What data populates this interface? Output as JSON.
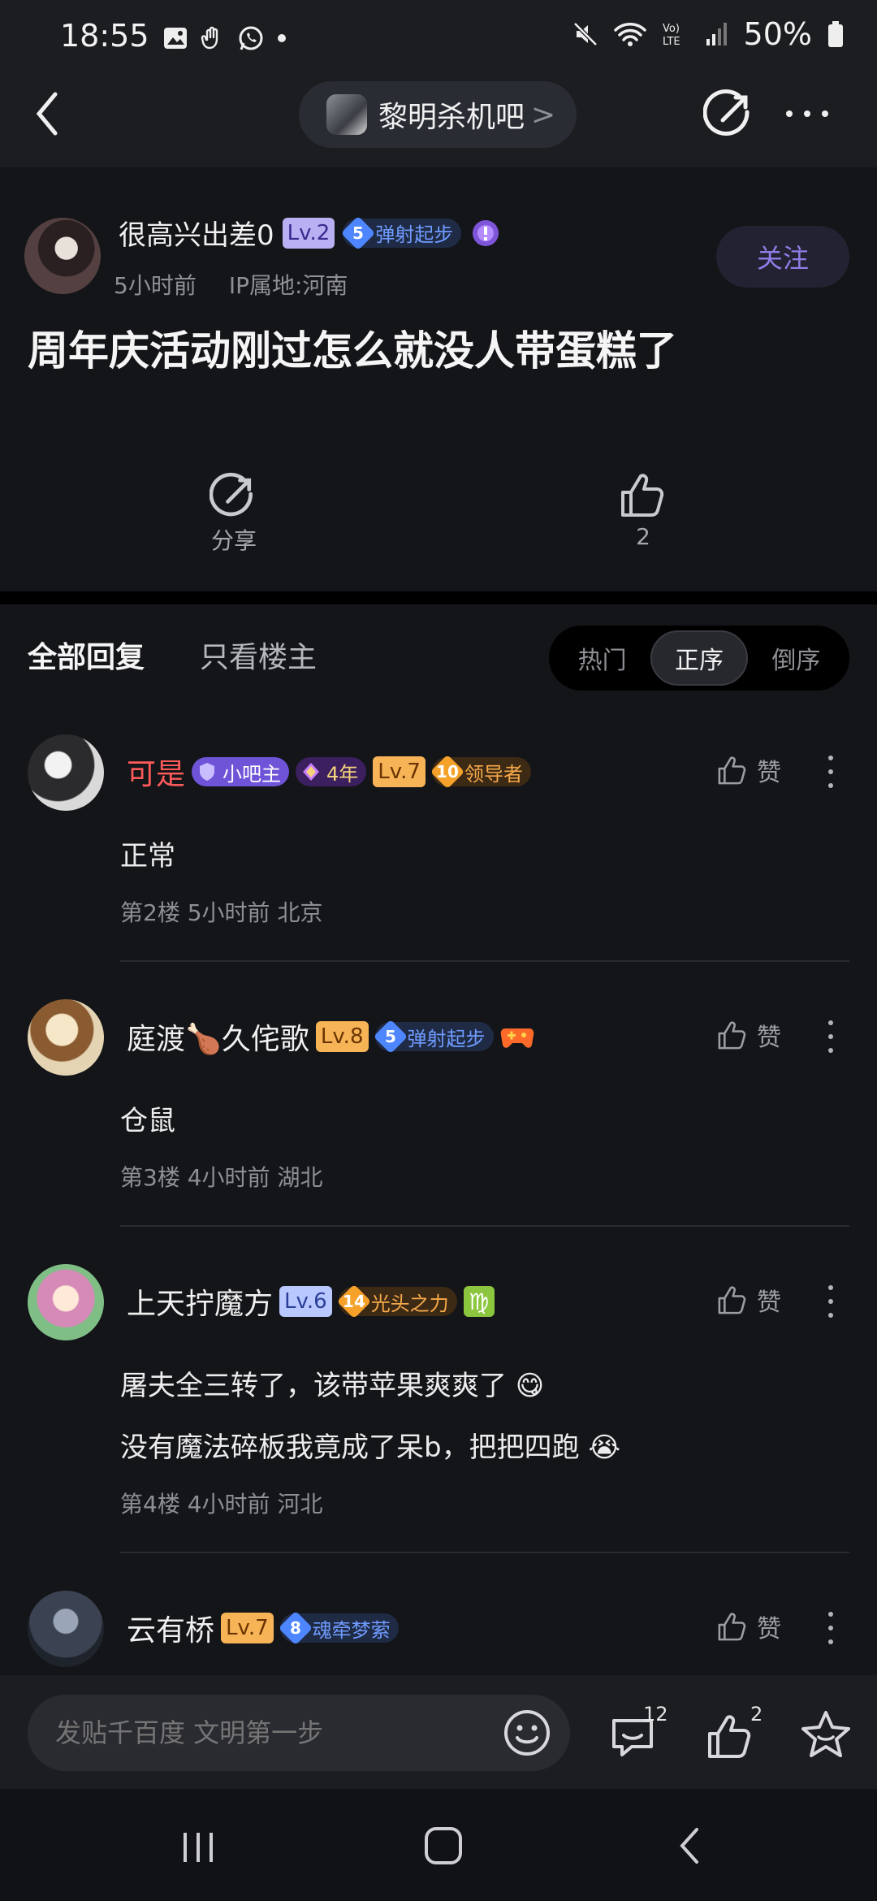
{
  "status_bar": {
    "time": "18:55",
    "battery": "50%"
  },
  "header": {
    "forum_name": "黎明杀机吧",
    "forum_chevron": ">"
  },
  "post": {
    "author": "很高兴出差0",
    "level": "Lv.2",
    "badge_num": "5",
    "badge_text": "弹射起步",
    "time": "5小时前",
    "ip": "IP属地:河南",
    "follow_label": "关注",
    "title": "周年庆活动刚过怎么就没人带蛋糕了",
    "share_label": "分享",
    "like_count": "2"
  },
  "reply_tabs": {
    "all": "全部回复",
    "op_only": "只看楼主",
    "sort": [
      "热门",
      "正序",
      "倒序"
    ]
  },
  "comments": [
    {
      "name": "可是",
      "name_color": "#ff5b5b",
      "role": "小吧主",
      "years": "4年",
      "level": "Lv.7",
      "badge_num": "10",
      "badge_text": "领导者",
      "body": [
        "正常"
      ],
      "floor": "第2楼",
      "time": "5小时前",
      "loc": "北京",
      "like_label": "赞"
    },
    {
      "name": "庭渡🍗久侘歌",
      "name_color": "#f0f0f0",
      "level": "Lv.8",
      "badge_num": "5",
      "badge_text": "弹射起步",
      "body": [
        "仓鼠"
      ],
      "floor": "第3楼",
      "time": "4小时前",
      "loc": "湖北",
      "like_label": "赞"
    },
    {
      "name": "上天拧魔方",
      "name_color": "#f0f0f0",
      "level": "Lv.6",
      "badge_num": "14",
      "badge_text": "光头之力",
      "zodiac": "♍",
      "body": [
        "屠夫全三转了，该带苹果爽爽了 😋",
        "没有魔法碎板我竟成了呆b，把把四跑 😭"
      ],
      "floor": "第4楼",
      "time": "4小时前",
      "loc": "河北",
      "like_label": "赞"
    },
    {
      "name": "云有桥",
      "name_color": "#f0f0f0",
      "level": "Lv.7",
      "badge_num": "8",
      "badge_text": "魂牵梦萦",
      "like_label": "赞"
    }
  ],
  "bottom_bar": {
    "input_placeholder": "发贴千百度 文明第一步",
    "comment_count": "12",
    "like_count": "2"
  },
  "colors": {
    "accent": "#8f7ce6",
    "background": "#141518",
    "level_orange": "#f6a94a",
    "level_blue": "#6f8ff0"
  }
}
